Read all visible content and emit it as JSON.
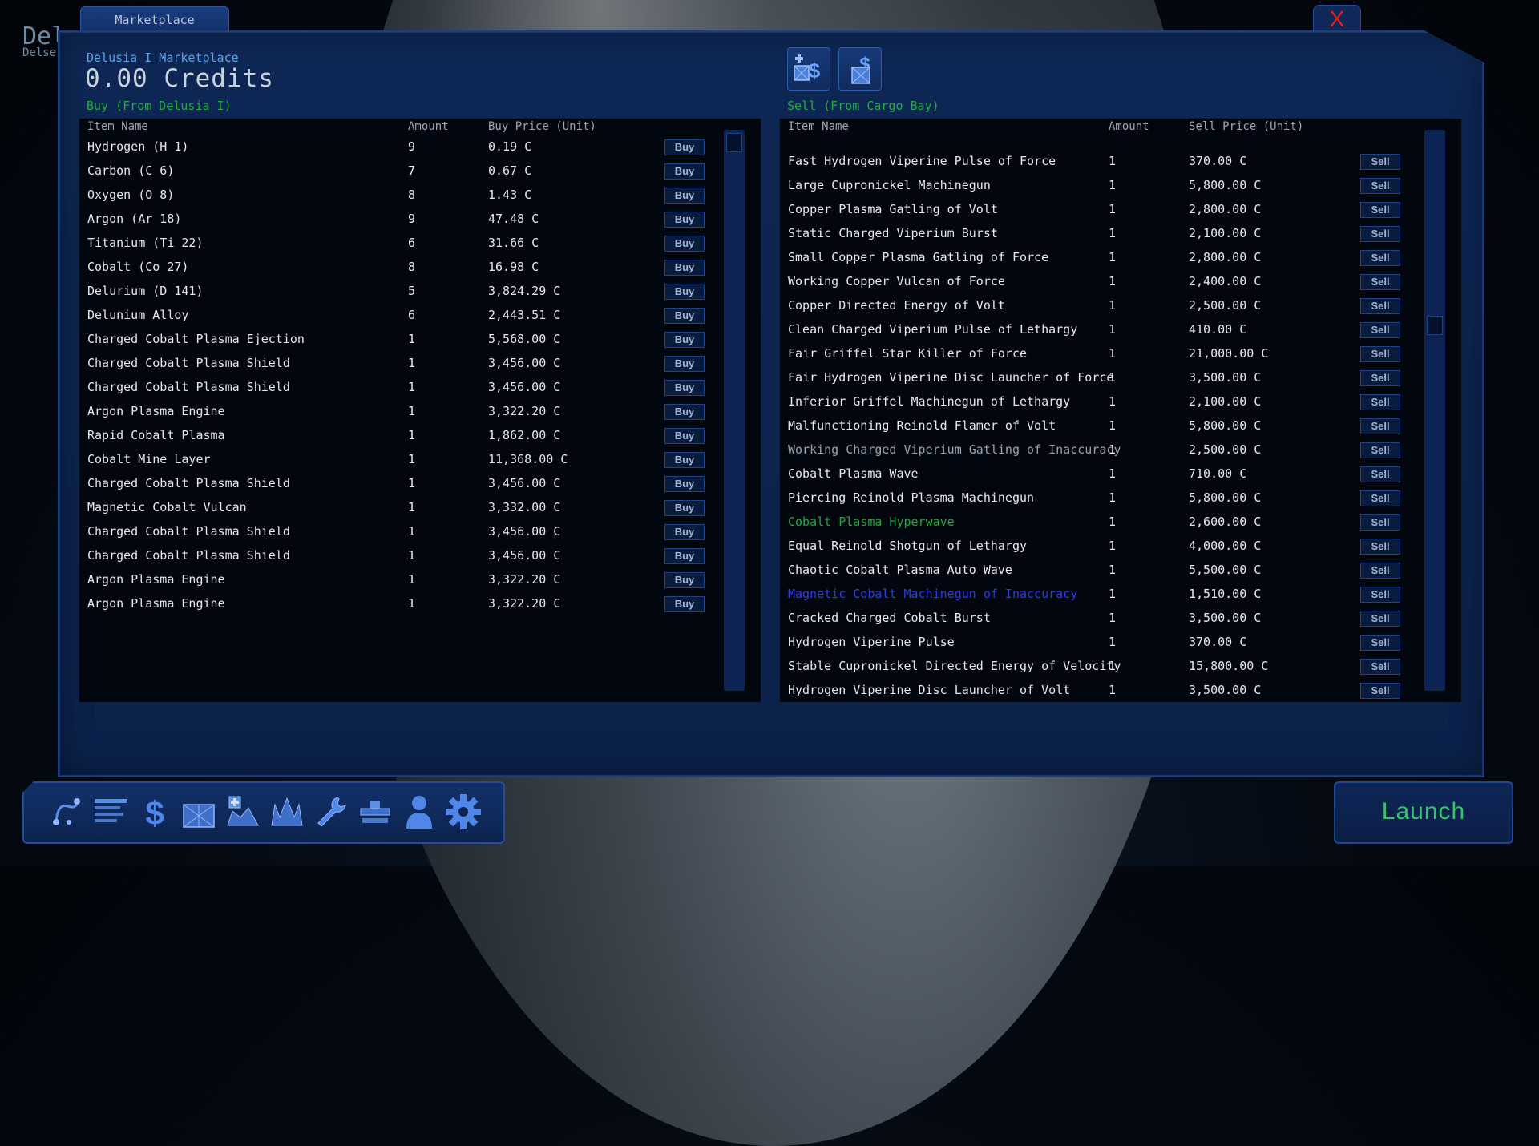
{
  "background": {
    "title": "Del",
    "subtitle": "Delse"
  },
  "window": {
    "tab_label": "Marketplace",
    "close_label": "X"
  },
  "market": {
    "name": "Delusia I Marketplace",
    "credits": "0.00 Credits",
    "buy_heading": "Buy (From Delusia I)",
    "sell_heading": "Sell (From Cargo Bay)"
  },
  "mode_buttons": [
    {
      "icon": "buy-mode-icon"
    },
    {
      "icon": "sell-mode-icon"
    }
  ],
  "buy_table": {
    "headers": {
      "name": "Item Name",
      "amount": "Amount",
      "price": "Buy Price (Unit)"
    },
    "button_label": "Buy",
    "scroll_position": 0.0,
    "rows": [
      {
        "name": "Hydrogen (H 1)",
        "amount": "9",
        "price": "0.19 C"
      },
      {
        "name": "Carbon (C 6)",
        "amount": "7",
        "price": "0.67 C"
      },
      {
        "name": "Oxygen (O 8)",
        "amount": "8",
        "price": "1.43 C"
      },
      {
        "name": "Argon (Ar 18)",
        "amount": "9",
        "price": "47.48 C"
      },
      {
        "name": "Titanium (Ti 22)",
        "amount": "6",
        "price": "31.66 C"
      },
      {
        "name": "Cobalt (Co 27)",
        "amount": "8",
        "price": "16.98 C"
      },
      {
        "name": "Delurium (D 141)",
        "amount": "5",
        "price": "3,824.29 C"
      },
      {
        "name": "Delunium Alloy",
        "amount": "6",
        "price": "2,443.51 C"
      },
      {
        "name": "Charged Cobalt Plasma Ejection",
        "amount": "1",
        "price": "5,568.00 C"
      },
      {
        "name": "Charged Cobalt Plasma Shield",
        "amount": "1",
        "price": "3,456.00 C"
      },
      {
        "name": "Charged Cobalt Plasma Shield",
        "amount": "1",
        "price": "3,456.00 C"
      },
      {
        "name": "Argon Plasma Engine",
        "amount": "1",
        "price": "3,322.20 C"
      },
      {
        "name": "Rapid Cobalt Plasma",
        "amount": "1",
        "price": "1,862.00 C"
      },
      {
        "name": "Cobalt Mine Layer",
        "amount": "1",
        "price": "11,368.00 C"
      },
      {
        "name": "Charged Cobalt Plasma Shield",
        "amount": "1",
        "price": "3,456.00 C"
      },
      {
        "name": "Magnetic Cobalt Vulcan",
        "amount": "1",
        "price": "3,332.00 C"
      },
      {
        "name": "Charged Cobalt Plasma Shield",
        "amount": "1",
        "price": "3,456.00 C"
      },
      {
        "name": "Charged Cobalt Plasma Shield",
        "amount": "1",
        "price": "3,456.00 C"
      },
      {
        "name": "Argon Plasma Engine",
        "amount": "1",
        "price": "3,322.20 C"
      },
      {
        "name": "Argon Plasma Engine",
        "amount": "1",
        "price": "3,322.20 C"
      }
    ]
  },
  "sell_table": {
    "headers": {
      "name": "Item Name",
      "amount": "Amount",
      "price": "Sell Price (Unit)"
    },
    "button_label": "Sell",
    "scroll_position": 0.34,
    "rows": [
      {
        "name": "Fast Hydrogen Viperine Pulse of Force",
        "amount": "1",
        "price": "370.00 C",
        "color": "#e4e9ef"
      },
      {
        "name": "Large Cupronickel Machinegun",
        "amount": "1",
        "price": "5,800.00 C",
        "color": "#e4e9ef"
      },
      {
        "name": "Copper Plasma Gatling of Volt",
        "amount": "1",
        "price": "2,800.00 C",
        "color": "#e4e9ef"
      },
      {
        "name": "Static Charged Viperium Burst",
        "amount": "1",
        "price": "2,100.00 C",
        "color": "#e4e9ef"
      },
      {
        "name": "Small Copper Plasma Gatling of Force",
        "amount": "1",
        "price": "2,800.00 C",
        "color": "#e4e9ef"
      },
      {
        "name": "Working Copper Vulcan of Force",
        "amount": "1",
        "price": "2,400.00 C",
        "color": "#e4e9ef"
      },
      {
        "name": "Copper Directed Energy of Volt",
        "amount": "1",
        "price": "2,500.00 C",
        "color": "#e4e9ef"
      },
      {
        "name": "Clean Charged Viperium Pulse of Lethargy",
        "amount": "1",
        "price": "410.00 C",
        "color": "#e4e9ef"
      },
      {
        "name": "Fair Griffel Star Killer of Force",
        "amount": "1",
        "price": "21,000.00 C",
        "color": "#e4e9ef"
      },
      {
        "name": "Fair Hydrogen Viperine Disc Launcher of Force",
        "amount": "1",
        "price": "3,500.00 C",
        "color": "#e4e9ef"
      },
      {
        "name": "Inferior Griffel Machinegun of Lethargy",
        "amount": "1",
        "price": "2,100.00 C",
        "color": "#e4e9ef"
      },
      {
        "name": "Malfunctioning Reinold Flamer of Volt",
        "amount": "1",
        "price": "5,800.00 C",
        "color": "#e4e9ef"
      },
      {
        "name": "Working Charged Viperium Gatling of Inaccuracy",
        "amount": "1",
        "price": "2,500.00 C",
        "color": "#9aa3ad"
      },
      {
        "name": "Cobalt Plasma Wave",
        "amount": "1",
        "price": "710.00 C",
        "color": "#e4e9ef"
      },
      {
        "name": "Piercing Reinold Plasma Machinegun",
        "amount": "1",
        "price": "5,800.00 C",
        "color": "#e4e9ef"
      },
      {
        "name": "Cobalt Plasma Hyperwave",
        "amount": "1",
        "price": "2,600.00 C",
        "color": "#22a83a"
      },
      {
        "name": "Equal Reinold Shotgun of Lethargy",
        "amount": "1",
        "price": "4,000.00 C",
        "color": "#e4e9ef"
      },
      {
        "name": "Chaotic Cobalt Plasma Auto Wave",
        "amount": "1",
        "price": "5,500.00 C",
        "color": "#e4e9ef"
      },
      {
        "name": "Magnetic Cobalt Machinegun of Inaccuracy",
        "amount": "1",
        "price": "1,510.00 C",
        "color": "#2a3fe0"
      },
      {
        "name": "Cracked Charged Cobalt Burst",
        "amount": "1",
        "price": "3,500.00 C",
        "color": "#e4e9ef"
      },
      {
        "name": "Hydrogen Viperine Pulse",
        "amount": "1",
        "price": "370.00 C",
        "color": "#e4e9ef"
      },
      {
        "name": "Stable Cupronickel Directed Energy of Velocity",
        "amount": "1",
        "price": "15,800.00 C",
        "color": "#e4e9ef"
      },
      {
        "name": "Hydrogen Viperine Disc Launcher of Volt",
        "amount": "1",
        "price": "3,500.00 C",
        "color": "#e4e9ef"
      }
    ]
  },
  "toolbar": [
    {
      "icon": "route-icon"
    },
    {
      "icon": "log-list-icon"
    },
    {
      "icon": "dollar-icon"
    },
    {
      "icon": "cargo-icon"
    },
    {
      "icon": "shipyard-icon"
    },
    {
      "icon": "fleet-icon"
    },
    {
      "icon": "wrench-icon"
    },
    {
      "icon": "station-icon"
    },
    {
      "icon": "crew-icon"
    },
    {
      "icon": "settings-gear-icon"
    }
  ],
  "launch_label": "Launch",
  "colors": {
    "accent_blue": "#1b3f82",
    "heading_green": "#1fae38",
    "close_red": "#e81d1d",
    "launch_green": "#2ec866"
  }
}
